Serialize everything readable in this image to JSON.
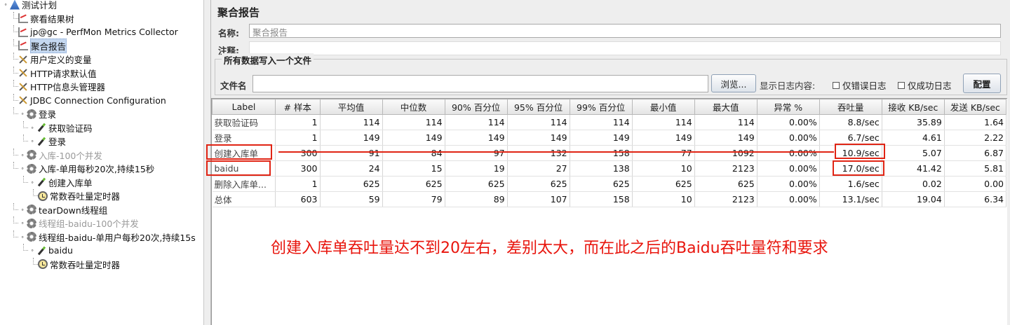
{
  "tree": [
    {
      "label": "测试计划",
      "icon": "test-plan-icon",
      "depth": 0,
      "toggle": "expanded",
      "state": "normal"
    },
    {
      "label": "察看结果树",
      "icon": "graph-icon",
      "depth": 1,
      "state": "normal"
    },
    {
      "label": "jp@gc - PerfMon Metrics Collector",
      "icon": "graph-icon",
      "depth": 1,
      "state": "normal"
    },
    {
      "label": "聚合报告",
      "icon": "graph-icon",
      "depth": 1,
      "state": "selected"
    },
    {
      "label": "用户定义的变量",
      "icon": "wrench-icon",
      "depth": 1,
      "state": "normal"
    },
    {
      "label": "HTTP请求默认值",
      "icon": "wrench-icon",
      "depth": 1,
      "state": "normal"
    },
    {
      "label": "HTTP信息头管理器",
      "icon": "wrench-icon",
      "depth": 1,
      "state": "normal"
    },
    {
      "label": "JDBC Connection Configuration",
      "icon": "wrench-icon",
      "depth": 1,
      "state": "normal"
    },
    {
      "label": "登录",
      "icon": "gear-icon",
      "depth": 1,
      "toggle": "expanded",
      "state": "normal"
    },
    {
      "label": "获取验证码",
      "icon": "pen-icon",
      "depth": 2,
      "toggle": "collapsed",
      "state": "normal"
    },
    {
      "label": "登录",
      "icon": "pen-icon",
      "depth": 2,
      "toggle": "collapsed",
      "state": "normal"
    },
    {
      "label": "入库-100个并发",
      "icon": "gear-icon",
      "depth": 1,
      "toggle": "collapsed",
      "state": "disabled"
    },
    {
      "label": "入库-单用每秒20次,持续15秒",
      "icon": "gear-icon",
      "depth": 1,
      "toggle": "expanded",
      "state": "normal"
    },
    {
      "label": "创建入库单",
      "icon": "pen-icon",
      "depth": 2,
      "toggle": "expanded",
      "state": "normal"
    },
    {
      "label": "常数吞吐量定时器",
      "icon": "timer-icon",
      "depth": 3,
      "state": "normal"
    },
    {
      "label": "tearDown线程组",
      "icon": "gear-icon",
      "depth": 1,
      "toggle": "collapsed",
      "state": "normal"
    },
    {
      "label": "线程组-baidu-100个并发",
      "icon": "gear-icon",
      "depth": 1,
      "toggle": "collapsed",
      "state": "disabled"
    },
    {
      "label": "线程组-baidu-单用户每秒20次,持续15s",
      "icon": "gear-icon",
      "depth": 1,
      "toggle": "expanded",
      "state": "normal"
    },
    {
      "label": "baidu",
      "icon": "pen-icon",
      "depth": 2,
      "toggle": "expanded",
      "state": "normal"
    },
    {
      "label": "常数吞吐量定时器",
      "icon": "timer-icon",
      "depth": 3,
      "state": "normal"
    }
  ],
  "panel": {
    "title": "聚合报告",
    "name_label": "名称:",
    "name_value": "聚合报告",
    "comments_label": "注释:",
    "comments_value": "",
    "file_section_title": "所有数据写入一个文件",
    "filename_label": "文件名",
    "filename_value": "",
    "browse_button": "浏览...",
    "log_content_label": "显示日志内容:",
    "errors_only_label": "仅错误日志",
    "success_only_label": "仅成功日志",
    "configure_button": "配置"
  },
  "table": {
    "columns": [
      "Label",
      "# 样本",
      "平均值",
      "中位数",
      "90% 百分位",
      "95% 百分位",
      "99% 百分位",
      "最小值",
      "最大值",
      "异常 %",
      "吞吐量",
      "接收 KB/sec",
      "发送 KB/sec"
    ],
    "rows": [
      [
        "获取验证码",
        "1",
        "114",
        "114",
        "114",
        "114",
        "114",
        "114",
        "114",
        "0.00%",
        "8.8/sec",
        "35.89",
        "1.64"
      ],
      [
        "登录",
        "1",
        "149",
        "149",
        "149",
        "149",
        "149",
        "149",
        "149",
        "0.00%",
        "6.7/sec",
        "4.61",
        "2.22"
      ],
      [
        "创建入库单",
        "300",
        "91",
        "84",
        "97",
        "132",
        "158",
        "77",
        "1092",
        "0.00%",
        "10.9/sec",
        "5.07",
        "6.87"
      ],
      [
        "baidu",
        "300",
        "24",
        "15",
        "19",
        "27",
        "138",
        "10",
        "2123",
        "0.00%",
        "17.0/sec",
        "41.42",
        "5.81"
      ],
      [
        "删除入库单...",
        "1",
        "625",
        "625",
        "625",
        "625",
        "625",
        "625",
        "625",
        "0.00%",
        "1.6/sec",
        "0.02",
        "0.00"
      ],
      [
        "总体",
        "603",
        "59",
        "79",
        "89",
        "107",
        "158",
        "10",
        "2123",
        "0.00%",
        "13.1/sec",
        "19.04",
        "6.34"
      ]
    ]
  },
  "annotation": {
    "text": "创建入库单吞吐量达不到20左右，差别太大，而在此之后的Baidu吞吐量符和要求",
    "color": "#e02414"
  }
}
